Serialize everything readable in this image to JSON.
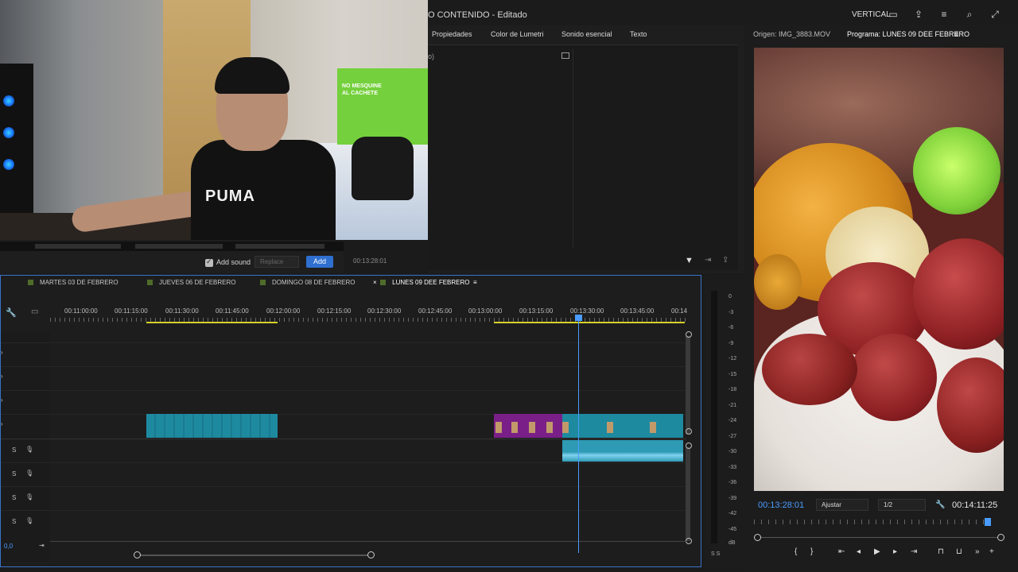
{
  "window": {
    "title": "O CONTENIDO - Editado",
    "workspace_label": "VERTICAL"
  },
  "effects_panel": {
    "tabs": [
      "Propiedades",
      "Color de Lumetri",
      "Sonido esencial",
      "Texto"
    ],
    "fragment_left": "o)",
    "timecode": "00:13:28:01"
  },
  "source_strip": {
    "add_sound_label": "Add sound",
    "replace_label": "Replace",
    "add_button_label": "Add"
  },
  "timeline": {
    "sequence_tabs": [
      {
        "label": "MARTES 03 DE FEBRERO",
        "active": false
      },
      {
        "label": "JUEVES 06 DE FEBRERO",
        "active": false
      },
      {
        "label": "DOMINGO 08 DE FEBRERO",
        "active": false
      },
      {
        "label": "LUNES 09 DEE FEBRERO",
        "active": true
      }
    ],
    "close_glyph": "×",
    "menu_glyph": "≡",
    "ruler_labels": [
      "00:11:00:00",
      "00:11:15:00",
      "00:11:30:00",
      "00:11:45:00",
      "00:12:00:00",
      "00:12:15:00",
      "00:12:30:00",
      "00:12:45:00",
      "00:13:00:00",
      "00:13:15:00",
      "00:13:30:00",
      "00:13:45:00",
      "00:14"
    ],
    "ruler_label_hidden": "00:",
    "audio_track_s_label": "S",
    "zoom_value": "0,0"
  },
  "audio_meter": {
    "scale": [
      "0",
      "-3",
      "-6",
      "-9",
      "-12",
      "-15",
      "-18",
      "-21",
      "-24",
      "-27",
      "-30",
      "-33",
      "-36",
      "-39",
      "-42",
      "-45",
      "dB"
    ],
    "solo_label": "S S"
  },
  "program_monitor": {
    "source_tab": "Origen: IMG_3883.MOV",
    "program_tab": "Programa: LUNES 09 DEE FEBRERO",
    "current_timecode": "00:13:28:01",
    "fit_option": "Ajustar",
    "resolution_option": "1/2",
    "duration_timecode": "00:14:11:25"
  },
  "colors": {
    "accent_blue": "#2f6fd0",
    "playhead_blue": "#4a9cff",
    "clip_teal": "#1e8aa0",
    "clip_purple": "#7a1f87",
    "inout_yellow": "#d7d12a"
  },
  "webcam": {
    "shirt_text": "PUMA",
    "poster_text": "NO MESQUINE AL CACHETE"
  }
}
